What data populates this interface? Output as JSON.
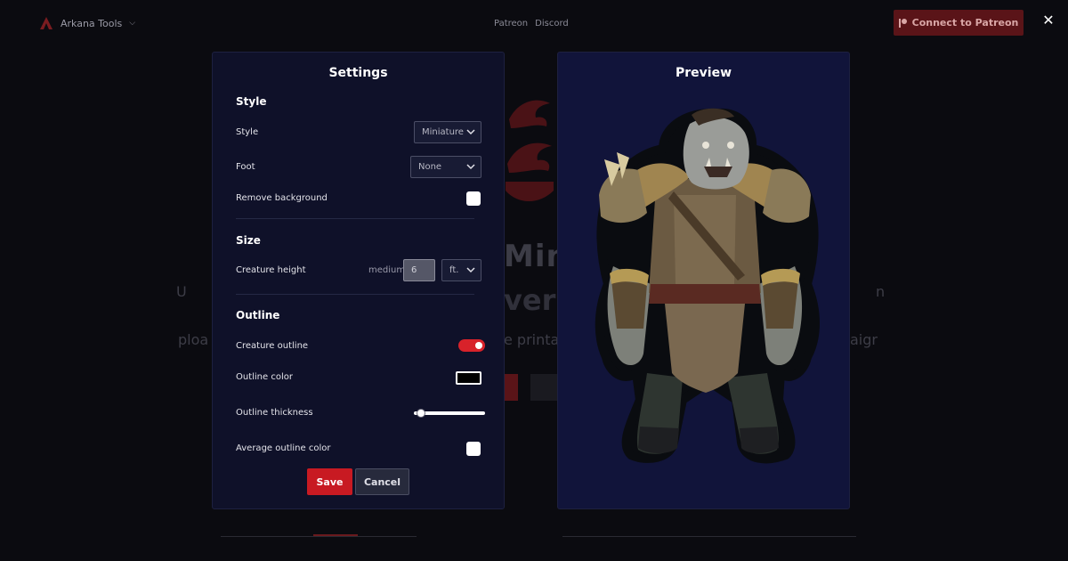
{
  "background": {
    "brand": "Arkana Tools",
    "nav_links": [
      "Patreon",
      "Discord"
    ],
    "patreon_button": "Connect to Patreon",
    "hero_title": "Min",
    "hero_subtitle": "ver",
    "hero_text_fragments": [
      "U",
      "n",
      "ploa",
      "e printa",
      "aigr"
    ]
  },
  "settings": {
    "title": "Settings",
    "style_section": {
      "title": "Style",
      "style_label": "Style",
      "style_value": "Miniature",
      "foot_label": "Foot",
      "foot_value": "None",
      "remove_bg_label": "Remove background",
      "remove_bg_checked": false
    },
    "size_section": {
      "title": "Size",
      "creature_height_label": "Creature height",
      "size_category": "medium",
      "height_value": "6",
      "unit_value": "ft."
    },
    "outline_section": {
      "title": "Outline",
      "creature_outline_label": "Creature outline",
      "creature_outline_on": true,
      "outline_color_label": "Outline color",
      "outline_color": "#000000",
      "outline_thickness_label": "Outline thickness",
      "outline_thickness_fraction": 0.1,
      "average_color_label": "Average outline color",
      "average_color_checked": false
    },
    "save_label": "Save",
    "cancel_label": "Cancel"
  },
  "preview": {
    "title": "Preview"
  },
  "colors": {
    "accent_red": "#c81a22",
    "panel_bg": "#0f1129",
    "preview_bg": "#11143a"
  }
}
